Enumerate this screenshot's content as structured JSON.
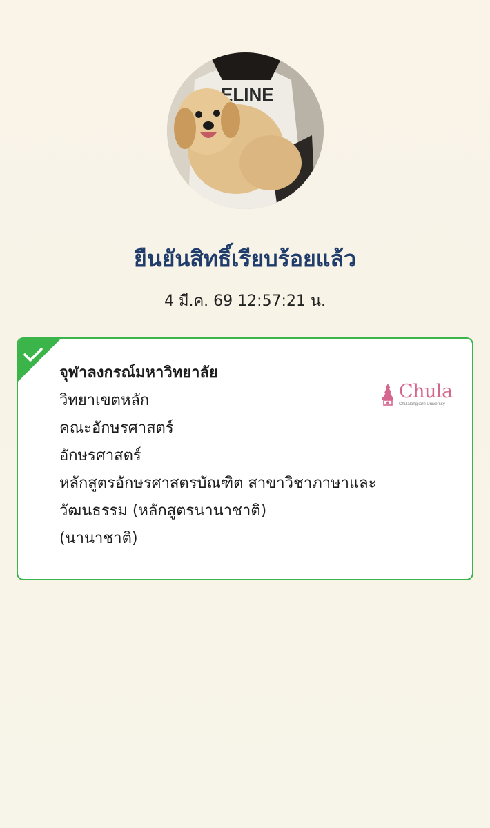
{
  "header": {
    "status_title": "ยืนยันสิทธิ์เรียบร้อยแล้ว",
    "timestamp": "4 มี.ค. 69 12:57:21 น."
  },
  "card": {
    "border_color": "#3bb54a",
    "lines": [
      "จุฬาลงกรณ์มหาวิทยาลัย",
      "วิทยาเขตหลัก",
      "คณะอักษรศาสตร์",
      "อักษรศาสตร์",
      "หลักสูตรอักษรศาสตรบัณฑิต สาขาวิชาภาษาและ",
      "วัฒนธรรม (หลักสูตรนานาชาติ)",
      "(นานาชาติ)"
    ],
    "logo": {
      "word": "Chula",
      "subtitle": "Chulalongkorn University",
      "color": "#d5678f"
    }
  },
  "colors": {
    "title": "#1f3c6b",
    "accent_green": "#3bb54a"
  }
}
